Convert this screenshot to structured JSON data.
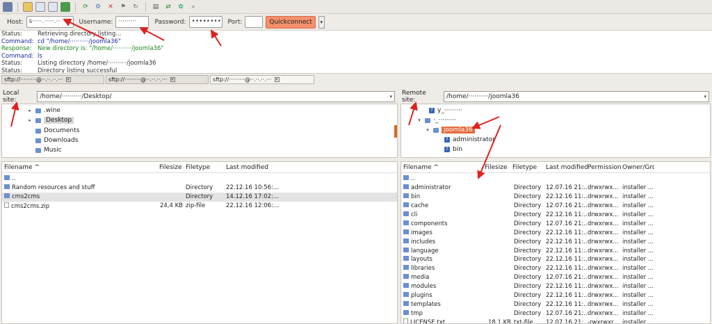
{
  "toolbar": {
    "icons": [
      "site-manager-icon",
      "toggle-log-icon",
      "toggle-tree-icon",
      "toggle-remote-tree-icon",
      "transfer-queue-icon",
      "refresh-icon",
      "process-queue-icon",
      "cancel-icon",
      "disconnect-icon",
      "reconnect-icon",
      "directory-filter-icon",
      "sync-browse-icon",
      "dir-compare-icon",
      "search-icon"
    ]
  },
  "quickconnect": {
    "host_label": "Host:",
    "host_value": "s·····.·····.··",
    "username_label": "Username:",
    "username_value": "·········",
    "password_label": "Password:",
    "password_value": "••••••••••••",
    "port_label": "Port:",
    "port_value": "",
    "button_label": "Quickconnect",
    "dropdown_symbol": "▾"
  },
  "log": [
    {
      "label": "Status:",
      "text": "Retrieving directory listing...",
      "kind": "status"
    },
    {
      "label": "Command:",
      "text": "cd \"/home/··········/joomla36\"",
      "kind": "command"
    },
    {
      "label": "Response:",
      "text": "New directory is: \"/home/··········/joomla36\"",
      "kind": "response"
    },
    {
      "label": "Command:",
      "text": "ls",
      "kind": "command"
    },
    {
      "label": "Status:",
      "text": "Listing directory /home/··········/joomla36",
      "kind": "status"
    },
    {
      "label": "Status:",
      "text": "Directory listing successful",
      "kind": "status"
    }
  ],
  "tabs": [
    {
      "label": "sftp://·········@··.··.··.···",
      "close": "×"
    },
    {
      "label": "sftp://·········@··.··.··.···",
      "close": "×"
    },
    {
      "label": "sftp://·········@··.··.··.···",
      "close": "×"
    }
  ],
  "local": {
    "site_label": "Local site:",
    "path": "/home/··········/Desktop/",
    "dropdown": "▾",
    "tree": [
      ".wine",
      "Desktop",
      "Documents",
      "Downloads",
      "Music"
    ],
    "headers": {
      "name": "Filename",
      "sort": "^",
      "size": "Filesize",
      "type": "Filetype",
      "modified": "Last modified"
    },
    "files": [
      {
        "name": "..",
        "size": "",
        "type": "",
        "modified": "",
        "kind": "folder"
      },
      {
        "name": "Random resources and stuff",
        "size": "",
        "type": "Directory",
        "modified": "22.12.16 10:56:...",
        "kind": "folder"
      },
      {
        "name": "cms2cms",
        "size": "",
        "type": "Directory",
        "modified": "14.12.16 17:02:...",
        "kind": "folder"
      },
      {
        "name": "cms2cms.zip",
        "size": "24,4 KB",
        "type": "zip-file",
        "modified": "22.12.16 12:06:...",
        "kind": "file"
      }
    ]
  },
  "remote": {
    "site_label": "Remote site:",
    "path": "/home/··········/joomla36",
    "dropdown": "▾",
    "tree": [
      "y_·········",
      "·_·········",
      "joomla36",
      "administrator",
      "bin"
    ],
    "headers": {
      "name": "Filename",
      "sort": "^",
      "size": "Filesize",
      "type": "Filetype",
      "modified": "Last modified",
      "permission": "Permission",
      "owner": "Owner/Gro"
    },
    "files": [
      {
        "name": "..",
        "size": "",
        "type": "",
        "modified": "",
        "perm": "",
        "owner": "",
        "kind": "folder"
      },
      {
        "name": "administrator",
        "size": "",
        "type": "Directory",
        "modified": "12.07.16 21:...",
        "perm": "drwxrwx...",
        "owner": "installer ...",
        "kind": "folder"
      },
      {
        "name": "bin",
        "size": "",
        "type": "Directory",
        "modified": "22.12.16 11:...",
        "perm": "drwxrwx...",
        "owner": "installer ...",
        "kind": "folder"
      },
      {
        "name": "cache",
        "size": "",
        "type": "Directory",
        "modified": "12.07.16 21:...",
        "perm": "drwxrwx...",
        "owner": "installer ...",
        "kind": "folder"
      },
      {
        "name": "cli",
        "size": "",
        "type": "Directory",
        "modified": "22.12.16 11:...",
        "perm": "drwxrwx...",
        "owner": "installer ...",
        "kind": "folder"
      },
      {
        "name": "components",
        "size": "",
        "type": "Directory",
        "modified": "12.07.16 21:...",
        "perm": "drwxrwx...",
        "owner": "installer ...",
        "kind": "folder"
      },
      {
        "name": "images",
        "size": "",
        "type": "Directory",
        "modified": "22.12.16 11:...",
        "perm": "drwxrwx...",
        "owner": "installer ...",
        "kind": "folder"
      },
      {
        "name": "includes",
        "size": "",
        "type": "Directory",
        "modified": "22.12.16 11:...",
        "perm": "drwxrwx...",
        "owner": "installer ...",
        "kind": "folder"
      },
      {
        "name": "language",
        "size": "",
        "type": "Directory",
        "modified": "22.12.16 11:...",
        "perm": "drwxrwx...",
        "owner": "installer ...",
        "kind": "folder"
      },
      {
        "name": "layouts",
        "size": "",
        "type": "Directory",
        "modified": "22.12.16 11:...",
        "perm": "drwxrwx...",
        "owner": "installer ...",
        "kind": "folder"
      },
      {
        "name": "libraries",
        "size": "",
        "type": "Directory",
        "modified": "22.12.16 11:...",
        "perm": "drwxrwx...",
        "owner": "installer ...",
        "kind": "folder"
      },
      {
        "name": "media",
        "size": "",
        "type": "Directory",
        "modified": "12.07.16 21:...",
        "perm": "drwxrwx...",
        "owner": "installer ...",
        "kind": "folder"
      },
      {
        "name": "modules",
        "size": "",
        "type": "Directory",
        "modified": "22.12.16 11:...",
        "perm": "drwxrwx...",
        "owner": "installer ...",
        "kind": "folder"
      },
      {
        "name": "plugins",
        "size": "",
        "type": "Directory",
        "modified": "22.12.16 11:...",
        "perm": "drwxrwx...",
        "owner": "installer ...",
        "kind": "folder"
      },
      {
        "name": "templates",
        "size": "",
        "type": "Directory",
        "modified": "22.12.16 11:...",
        "perm": "drwxrwx...",
        "owner": "installer ...",
        "kind": "folder"
      },
      {
        "name": "tmp",
        "size": "",
        "type": "Directory",
        "modified": "12.07.16 21:...",
        "perm": "drwxrwx...",
        "owner": "installer ...",
        "kind": "folder"
      },
      {
        "name": "LICENSE.txt",
        "size": "18,1 KB",
        "type": "txt-file",
        "modified": "12.07.16 21:...",
        "perm": "-rwxrwxr...",
        "owner": "installer ...",
        "kind": "file"
      }
    ]
  },
  "colors": {
    "accent": "#e46b3d",
    "annotation": "#e0201c",
    "folder": "#6a8fd0"
  }
}
